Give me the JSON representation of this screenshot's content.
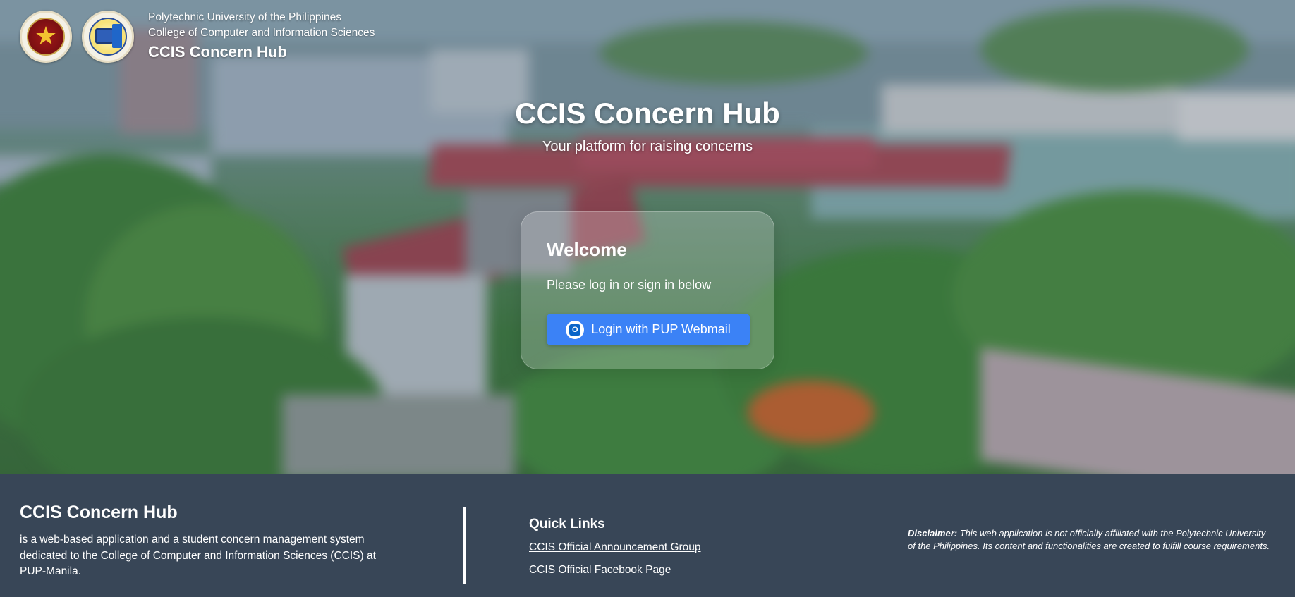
{
  "header": {
    "university": "Polytechnic University of the Philippines",
    "college": "College of Computer and Information Sciences",
    "app_name": "CCIS Concern Hub",
    "logos": [
      "pup-seal-icon",
      "ccis-seal-icon"
    ]
  },
  "hero": {
    "title": "CCIS Concern Hub",
    "subtitle": "Your platform for raising concerns"
  },
  "login_card": {
    "title": "Welcome",
    "text": "Please log in or sign in below",
    "button_label": "Login with PUP Webmail",
    "button_icon": "outlook-icon",
    "button_color": "#3b82f6"
  },
  "footer": {
    "title": "CCIS Concern Hub",
    "description": "is a web-based application and a student concern management system dedicated to the College of Computer and Information Sciences (CCIS) at PUP-Manila.",
    "quick_links_title": "Quick Links",
    "links": [
      "CCIS Official Announcement Group",
      "CCIS Official Facebook Page"
    ],
    "disclaimer_label": "Disclaimer:",
    "disclaimer_text": "This web application is not officially affiliated with the Polytechnic University of the Philippines. Its content and functionalities are created to fulfill course requirements.",
    "background_color": "#384657"
  }
}
